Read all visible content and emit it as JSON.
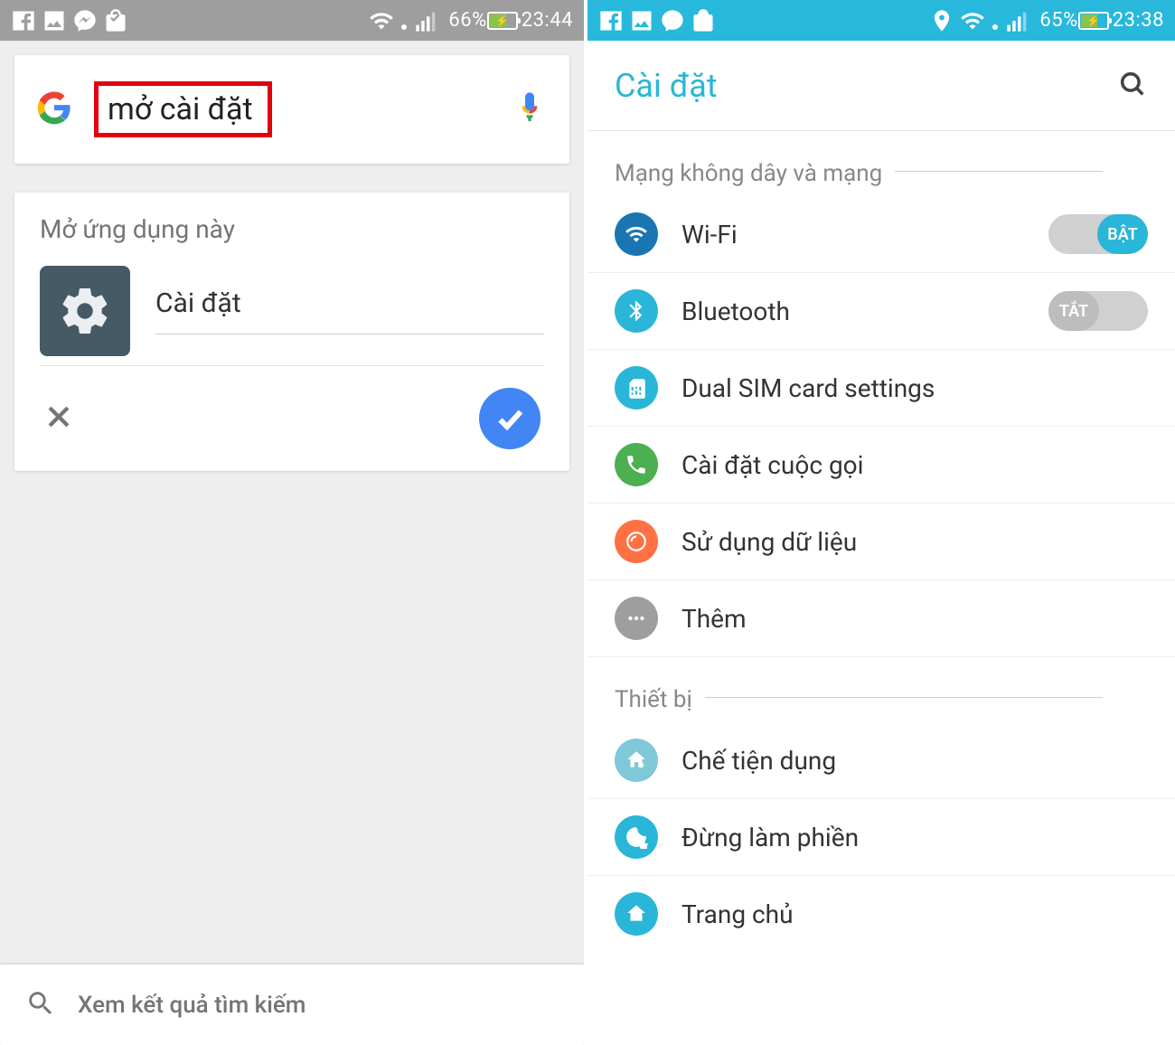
{
  "left": {
    "status": {
      "battery_pct": "66%",
      "time": "23:44"
    },
    "search_query": "mở cài đặt",
    "result": {
      "heading": "Mở ứng dụng này",
      "app_name": "Cài đặt"
    },
    "bottom_label": "Xem kết quả tìm kiếm"
  },
  "right": {
    "status": {
      "battery_pct": "65%",
      "time": "23:38"
    },
    "title": "Cài đặt",
    "sections": {
      "network": {
        "header": "Mạng không dây và mạng",
        "wifi": "Wi-Fi",
        "wifi_state": "BẬT",
        "bluetooth": "Bluetooth",
        "bt_state": "TẮT",
        "dual_sim": "Dual SIM card settings",
        "call": "Cài đặt cuộc gọi",
        "data": "Sử dụng dữ liệu",
        "more": "Thêm"
      },
      "device": {
        "header": "Thiết bị",
        "easy": "Chế tiện dụng",
        "dnd": "Đừng làm phiền",
        "home": "Trang chủ"
      }
    }
  }
}
